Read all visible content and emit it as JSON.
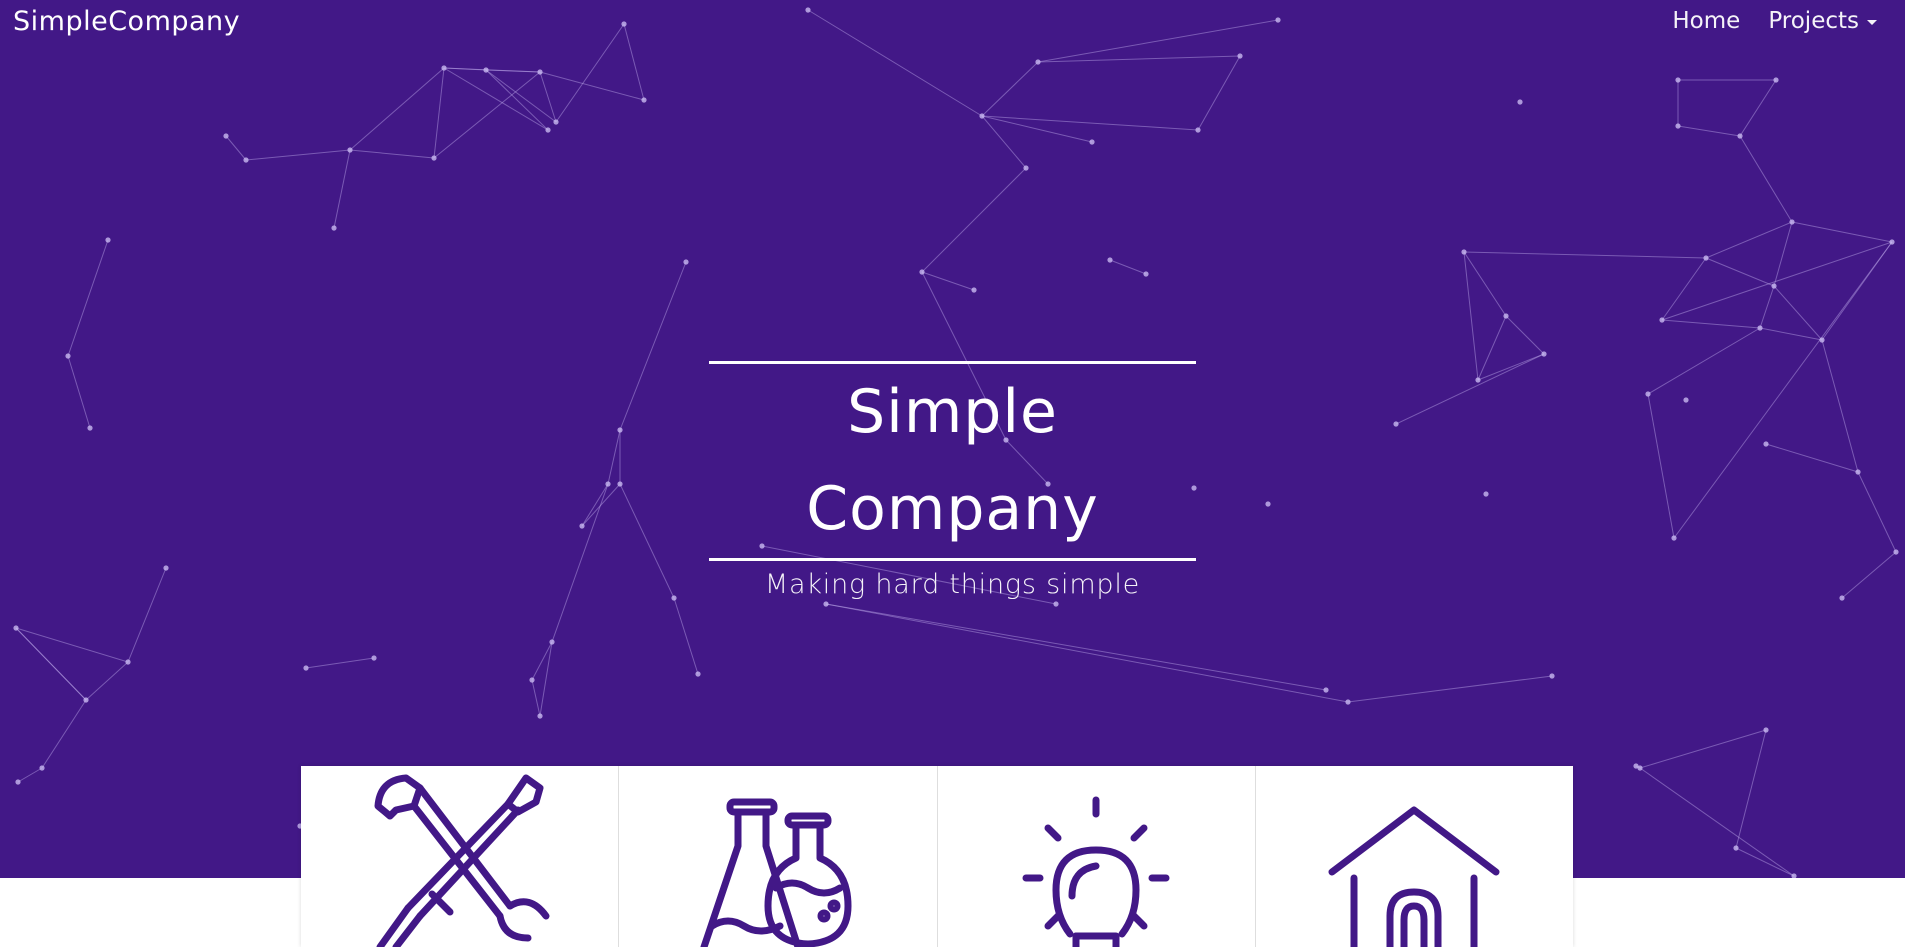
{
  "nav": {
    "brand": "SimpleCompany",
    "home": "Home",
    "projects": "Projects"
  },
  "hero": {
    "title": "Simple Company",
    "subtitle": "Making hard things simple"
  },
  "cards": [
    {
      "icon": "tools-icon"
    },
    {
      "icon": "flasks-icon"
    },
    {
      "icon": "lightbulb-icon"
    },
    {
      "icon": "house-icon"
    }
  ],
  "colors": {
    "hero_background": "#421887",
    "accent": "#421887",
    "text_on_hero": "#ffffff",
    "page_background": "#ffffff"
  }
}
